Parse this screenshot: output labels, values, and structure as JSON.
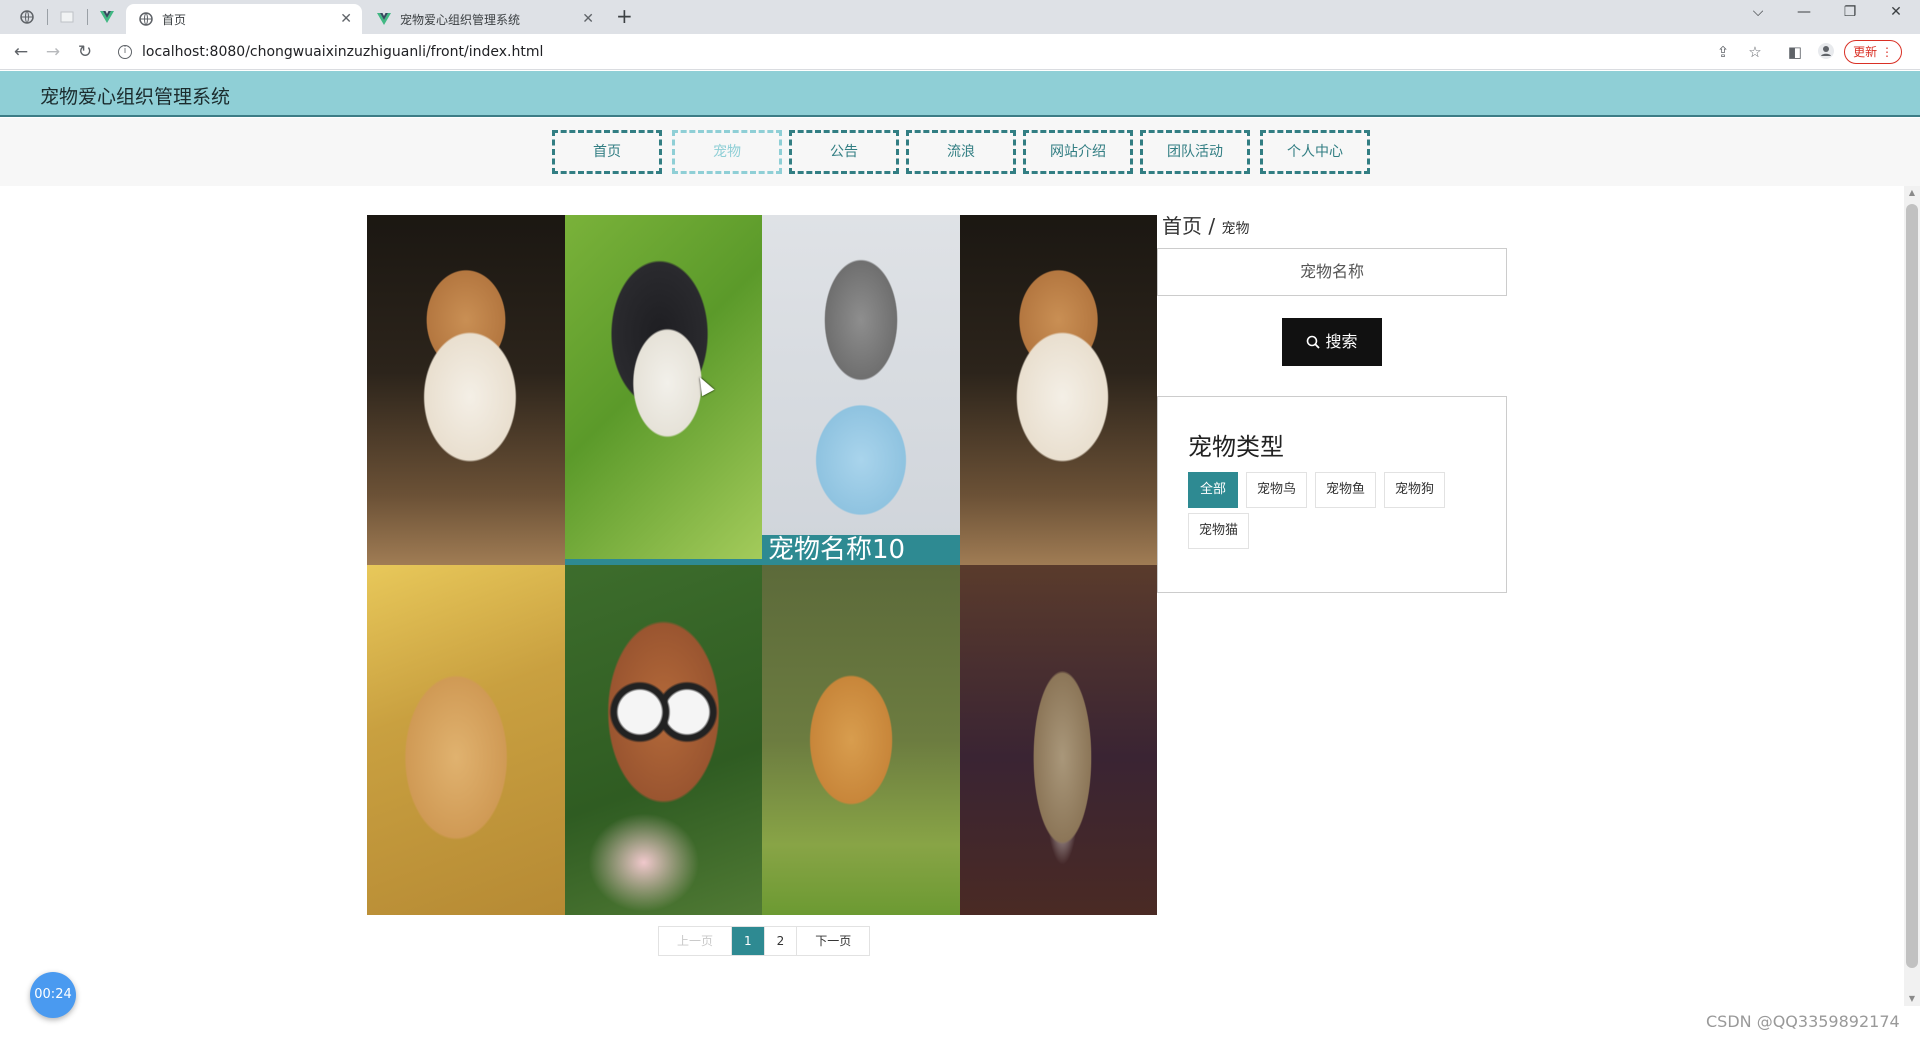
{
  "browser": {
    "tabs": [
      {
        "title": "首页",
        "active": true
      },
      {
        "title": "宠物爱心组织管理系统",
        "active": false
      }
    ],
    "url": "localhost:8080/chongwuaixinzuzhiguanli/front/index.html",
    "update_label": "更新"
  },
  "site": {
    "title": "宠物爱心组织管理系统"
  },
  "nav": {
    "items": [
      "首页",
      "宠物",
      "公告",
      "流浪",
      "网站介绍",
      "团队活动",
      "个人中心"
    ],
    "active": "宠物"
  },
  "gallery": {
    "cards": [
      {
        "subject": "corgi",
        "caption": ""
      },
      {
        "subject": "chihuahua",
        "caption": ""
      },
      {
        "subject": "schnauzer",
        "caption": "宠物名称10"
      },
      {
        "subject": "corgi",
        "caption": ""
      },
      {
        "subject": "golden-retriever",
        "caption": ""
      },
      {
        "subject": "poodle-with-glasses",
        "caption": ""
      },
      {
        "subject": "golden-retriever-lying",
        "caption": ""
      },
      {
        "subject": "tabby-cat",
        "caption": ""
      }
    ]
  },
  "pager": {
    "prev": "上一页",
    "current": "1",
    "page2": "2",
    "next": "下一页"
  },
  "sidebar": {
    "breadcrumb_home": "首页",
    "breadcrumb_sep": "/",
    "breadcrumb_current": "宠物",
    "search_placeholder": "宠物名称",
    "search_button": "搜索",
    "type_title": "宠物类型",
    "types": [
      "全部",
      "宠物鸟",
      "宠物鱼",
      "宠物狗",
      "宠物猫"
    ],
    "active_type": "全部"
  },
  "overlay": {
    "timer": "00:24",
    "watermark": "CSDN @QQ3359892174"
  },
  "colors": {
    "header_bg": "#8fcfd6",
    "accent": "#2e8a92",
    "nav_border": "#327e83"
  }
}
